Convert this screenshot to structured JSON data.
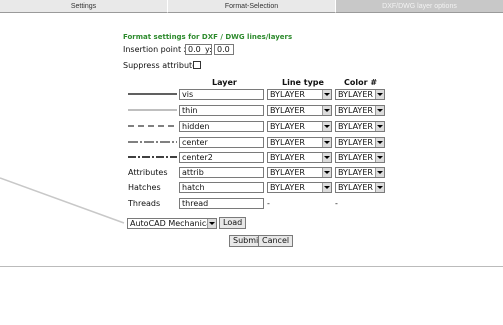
{
  "tabs": [
    "Settings",
    "Format-Selection",
    "DXF/DWG layer options"
  ],
  "heading": "Format settings for DXF / DWG lines/layers",
  "insertion": {
    "label": "Insertion point x:",
    "x_value": "0.0",
    "y_label": "y:",
    "y_value": "0.0"
  },
  "suppress_label": "Suppress attributes",
  "columns": {
    "layer": "Layer",
    "line_type": "Line type",
    "color": "Color #"
  },
  "rows": [
    {
      "label": "",
      "layer": "vis",
      "line_type": "BYLAYER",
      "color": "BYLAYER"
    },
    {
      "label": "",
      "layer": "thin",
      "line_type": "BYLAYER",
      "color": "BYLAYER"
    },
    {
      "label": "",
      "layer": "hidden",
      "line_type": "BYLAYER",
      "color": "BYLAYER"
    },
    {
      "label": "",
      "layer": "center",
      "line_type": "BYLAYER",
      "color": "BYLAYER"
    },
    {
      "label": "",
      "layer": "center2",
      "line_type": "BYLAYER",
      "color": "BYLAYER"
    },
    {
      "label": "Attributes",
      "layer": "attrib",
      "line_type": "BYLAYER",
      "color": "BYLAYER"
    },
    {
      "label": "Hatches",
      "layer": "hatch",
      "line_type": "BYLAYER",
      "color": "BYLAYER"
    },
    {
      "label": "Threads",
      "layer": "thread",
      "line_type": "-",
      "color": "-"
    }
  ],
  "preset": {
    "value": "AutoCAD Mechanical",
    "load_label": "Load"
  },
  "buttons": {
    "submit": "Submit",
    "cancel": "Cancel"
  },
  "colors": {
    "heading": "#2e8b2e",
    "active_tab_bg": "#c8c8c8"
  }
}
